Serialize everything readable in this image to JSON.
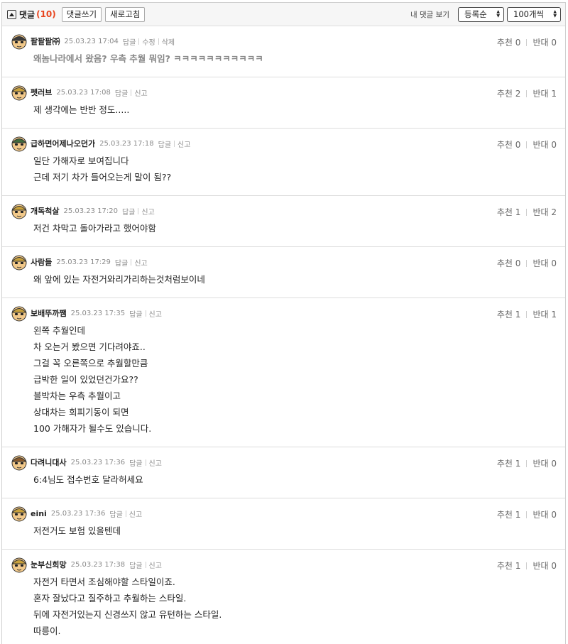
{
  "header": {
    "title": "댓글",
    "count": "(10)",
    "write_label": "댓글쓰기",
    "refresh_label": "새로고침",
    "my_comments_label": "내 댓글 보기",
    "sort_selected": "등록순",
    "per_page_selected": "100개씩"
  },
  "vote_labels": {
    "up": "추천",
    "down": "반대"
  },
  "comments": [
    {
      "nick": "팔팔팔㈜",
      "date": "25.03.23 17:04",
      "actions": [
        "답글",
        "수정",
        "삭제"
      ],
      "up": "0",
      "down": "0",
      "gray": true,
      "lines": [
        "왜놈나라에서 왔음? 우측 추월 뭐임? ㅋㅋㅋㅋㅋㅋㅋㅋㅋㅋㅋ"
      ]
    },
    {
      "nick": "펫러브",
      "date": "25.03.23 17:08",
      "actions": [
        "답글",
        "신고"
      ],
      "up": "2",
      "down": "1",
      "lines": [
        "제 생각에는 반반 정도....."
      ]
    },
    {
      "nick": "급하면어제나오던가",
      "date": "25.03.23 17:18",
      "actions": [
        "답글",
        "신고"
      ],
      "up": "0",
      "down": "0",
      "lines": [
        "일단 가해자로 보여집니다",
        "근데 저기 차가 들어오는게 말이 됨??"
      ]
    },
    {
      "nick": "개독척살",
      "date": "25.03.23 17:20",
      "actions": [
        "답글",
        "신고"
      ],
      "up": "1",
      "down": "2",
      "lines": [
        "저건 차막고 돌아가라고 했어야함"
      ]
    },
    {
      "nick": "사람들",
      "date": "25.03.23 17:29",
      "actions": [
        "답글",
        "신고"
      ],
      "up": "0",
      "down": "0",
      "lines": [
        "왜 앞에 있는 자전거와리가리하는것처럼보이네"
      ]
    },
    {
      "nick": "보배뚜까쨈",
      "date": "25.03.23 17:35",
      "actions": [
        "답글",
        "신고"
      ],
      "up": "1",
      "down": "1",
      "lines": [
        "왼쪽 추월인데",
        "차 오는거 봤으면 기다려야죠..",
        "그걸 꼭 오른쪽으로 추월할만큼",
        "급박한 일이 있었던건가요??",
        "블박차는 우측 추월이고",
        "상대차는 회피기동이 되면",
        "100 가해자가 될수도 있습니다."
      ]
    },
    {
      "nick": "다려니대사",
      "date": "25.03.23 17:36",
      "actions": [
        "답글",
        "신고"
      ],
      "up": "1",
      "down": "0",
      "lines": [
        "6:4님도 접수번호 달라허세요"
      ]
    },
    {
      "nick": "eini",
      "date": "25.03.23 17:36",
      "actions": [
        "답글",
        "신고"
      ],
      "up": "1",
      "down": "0",
      "lines": [
        "저전거도 보험 있을텐데"
      ]
    },
    {
      "nick": "눈부신희망",
      "date": "25.03.23 17:38",
      "actions": [
        "답글",
        "신고"
      ],
      "up": "1",
      "down": "0",
      "lines": [
        "자전거 타면서 조심해야할 스타일이죠.",
        "혼자 잘났다고 질주하고 추월하는 스타일.",
        "뒤에 자전거있는지 신경쓰지 않고 유턴하는 스타일.",
        "따릉이."
      ]
    }
  ]
}
